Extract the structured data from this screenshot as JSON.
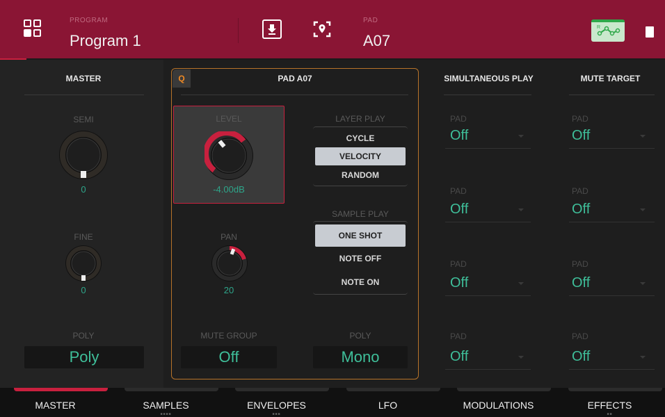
{
  "header": {
    "program_label": "PROGRAM",
    "program_name": "Program 1",
    "pad_label": "PAD",
    "pad_name": "A07"
  },
  "master": {
    "title": "MASTER",
    "semi_label": "SEMI",
    "semi_value": "0",
    "fine_label": "FINE",
    "fine_value": "0",
    "poly_label": "POLY",
    "poly_value": "Poly"
  },
  "pad": {
    "q_label": "Q",
    "title": "PAD A07",
    "level_label": "LEVEL",
    "level_value": "-4.00dB",
    "pan_label": "PAN",
    "pan_value": "20",
    "mute_group_label": "MUTE GROUP",
    "mute_group_value": "Off",
    "poly_label": "POLY",
    "poly_value": "Mono",
    "layer_play_label": "LAYER PLAY",
    "layer_play_options": [
      "CYCLE",
      "VELOCITY",
      "RANDOM"
    ],
    "layer_play_selected": "VELOCITY",
    "sample_play_label": "SAMPLE PLAY",
    "sample_play_options": [
      "ONE SHOT",
      "NOTE OFF",
      "NOTE ON"
    ],
    "sample_play_selected": "ONE SHOT"
  },
  "simultaneous_play": {
    "title": "SIMULTANEOUS PLAY",
    "slots": [
      {
        "label": "PAD",
        "value": "Off"
      },
      {
        "label": "PAD",
        "value": "Off"
      },
      {
        "label": "PAD",
        "value": "Off"
      },
      {
        "label": "PAD",
        "value": "Off"
      }
    ]
  },
  "mute_target": {
    "title": "MUTE TARGET",
    "slots": [
      {
        "label": "PAD",
        "value": "Off"
      },
      {
        "label": "PAD",
        "value": "Off"
      },
      {
        "label": "PAD",
        "value": "Off"
      },
      {
        "label": "PAD",
        "value": "Off"
      }
    ]
  },
  "tabs": [
    {
      "label": "MASTER",
      "active": true,
      "dots": ""
    },
    {
      "label": "SAMPLES",
      "active": false,
      "dots": "■■■■"
    },
    {
      "label": "ENVELOPES",
      "active": false,
      "dots": "■■■"
    },
    {
      "label": "LFO",
      "active": false,
      "dots": ""
    },
    {
      "label": "MODULATIONS",
      "active": false,
      "dots": ""
    },
    {
      "label": "EFFECTS",
      "active": false,
      "dots": "■■"
    }
  ],
  "colors": {
    "header_bg": "#8a1534",
    "accent_red": "#c8203e",
    "value_green": "#3fbf9a",
    "pad_border": "#b8742a",
    "q_orange": "#f08a24"
  },
  "icons": {
    "menu": "grid-icon",
    "save": "save-icon",
    "locate": "locate-icon",
    "modulation": "modulation-icon",
    "chip": "chip-icon"
  }
}
